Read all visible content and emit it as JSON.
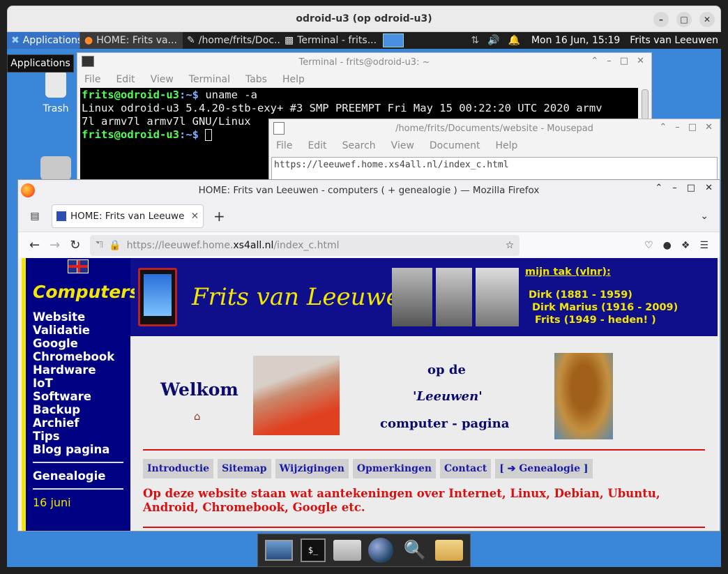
{
  "window": {
    "title": "odroid-u3 (op odroid-u3)"
  },
  "panel": {
    "applications": "Applications",
    "tasks": [
      "HOME:  Frits va...",
      "/home/frits/Doc...",
      "Terminal - frits..."
    ],
    "clock": "Mon 16 Jun, 15:19",
    "user": "Frits van Leeuwen",
    "tooltip": "Applications"
  },
  "desktop": {
    "trash": "Trash"
  },
  "terminal": {
    "title": "Terminal - frits@odroid-u3: ~",
    "menu": [
      "File",
      "Edit",
      "View",
      "Terminal",
      "Tabs",
      "Help"
    ],
    "prompt1": "frits@odroid-u3",
    "path1": ":~$ ",
    "cmd1": "uname -a",
    "out1": "Linux odroid-u3 5.4.20-stb-exy+ #3 SMP PREEMPT Fri May 15 00:22:20 UTC 2020 armv",
    "out2": "7l armv7l armv7l GNU/Linux",
    "prompt2": "frits@odroid-u3",
    "path2": ":~$ "
  },
  "mousepad": {
    "title": "/home/frits/Documents/website - Mousepad",
    "menu": [
      "File",
      "Edit",
      "Search",
      "View",
      "Document",
      "Help"
    ],
    "text": "https://leeuwef.home.xs4all.nl/index_c.html"
  },
  "firefox": {
    "title": "HOME:  Frits van Leeuwen - computers ( + genealogie ) — Mozilla Firefox",
    "tab": "HOME:  Frits van Leeuwe",
    "url_pre": "https://leeuwef.home.",
    "url_domain": "xs4all.nl",
    "url_post": "/index_c.html"
  },
  "site": {
    "sidebar_title": "Computers",
    "nav": [
      "Website",
      "Validatie",
      "Google",
      "Chromebook",
      "Hardware",
      "IoT",
      "Software",
      "Backup",
      "Archief",
      "Tips",
      "Blog pagina"
    ],
    "genealogie": "Genealogie",
    "date": "16 juni",
    "banner_name": "Frits van Leeuwen",
    "tak_title": "mijn tak (vlnr):",
    "tak": [
      "Dirk (1881 - 1959)",
      "Dirk Marius (1916 - 2009)",
      "Frits (1949 - heden! )"
    ],
    "welkom": "Welkom",
    "opde": "op de",
    "leeuwen": "'Leeuwen'",
    "computerpagina": "computer - pagina",
    "tabs": [
      "Introductie",
      "Sitemap",
      "Wijzigingen",
      "Opmerkingen",
      "Contact",
      "[ ➔ Genealogie ]"
    ],
    "intro": "Op deze website staan wat aantekeningen over Internet, Linux, Debian, Ubuntu, Android, Chromebook, Google etc."
  }
}
